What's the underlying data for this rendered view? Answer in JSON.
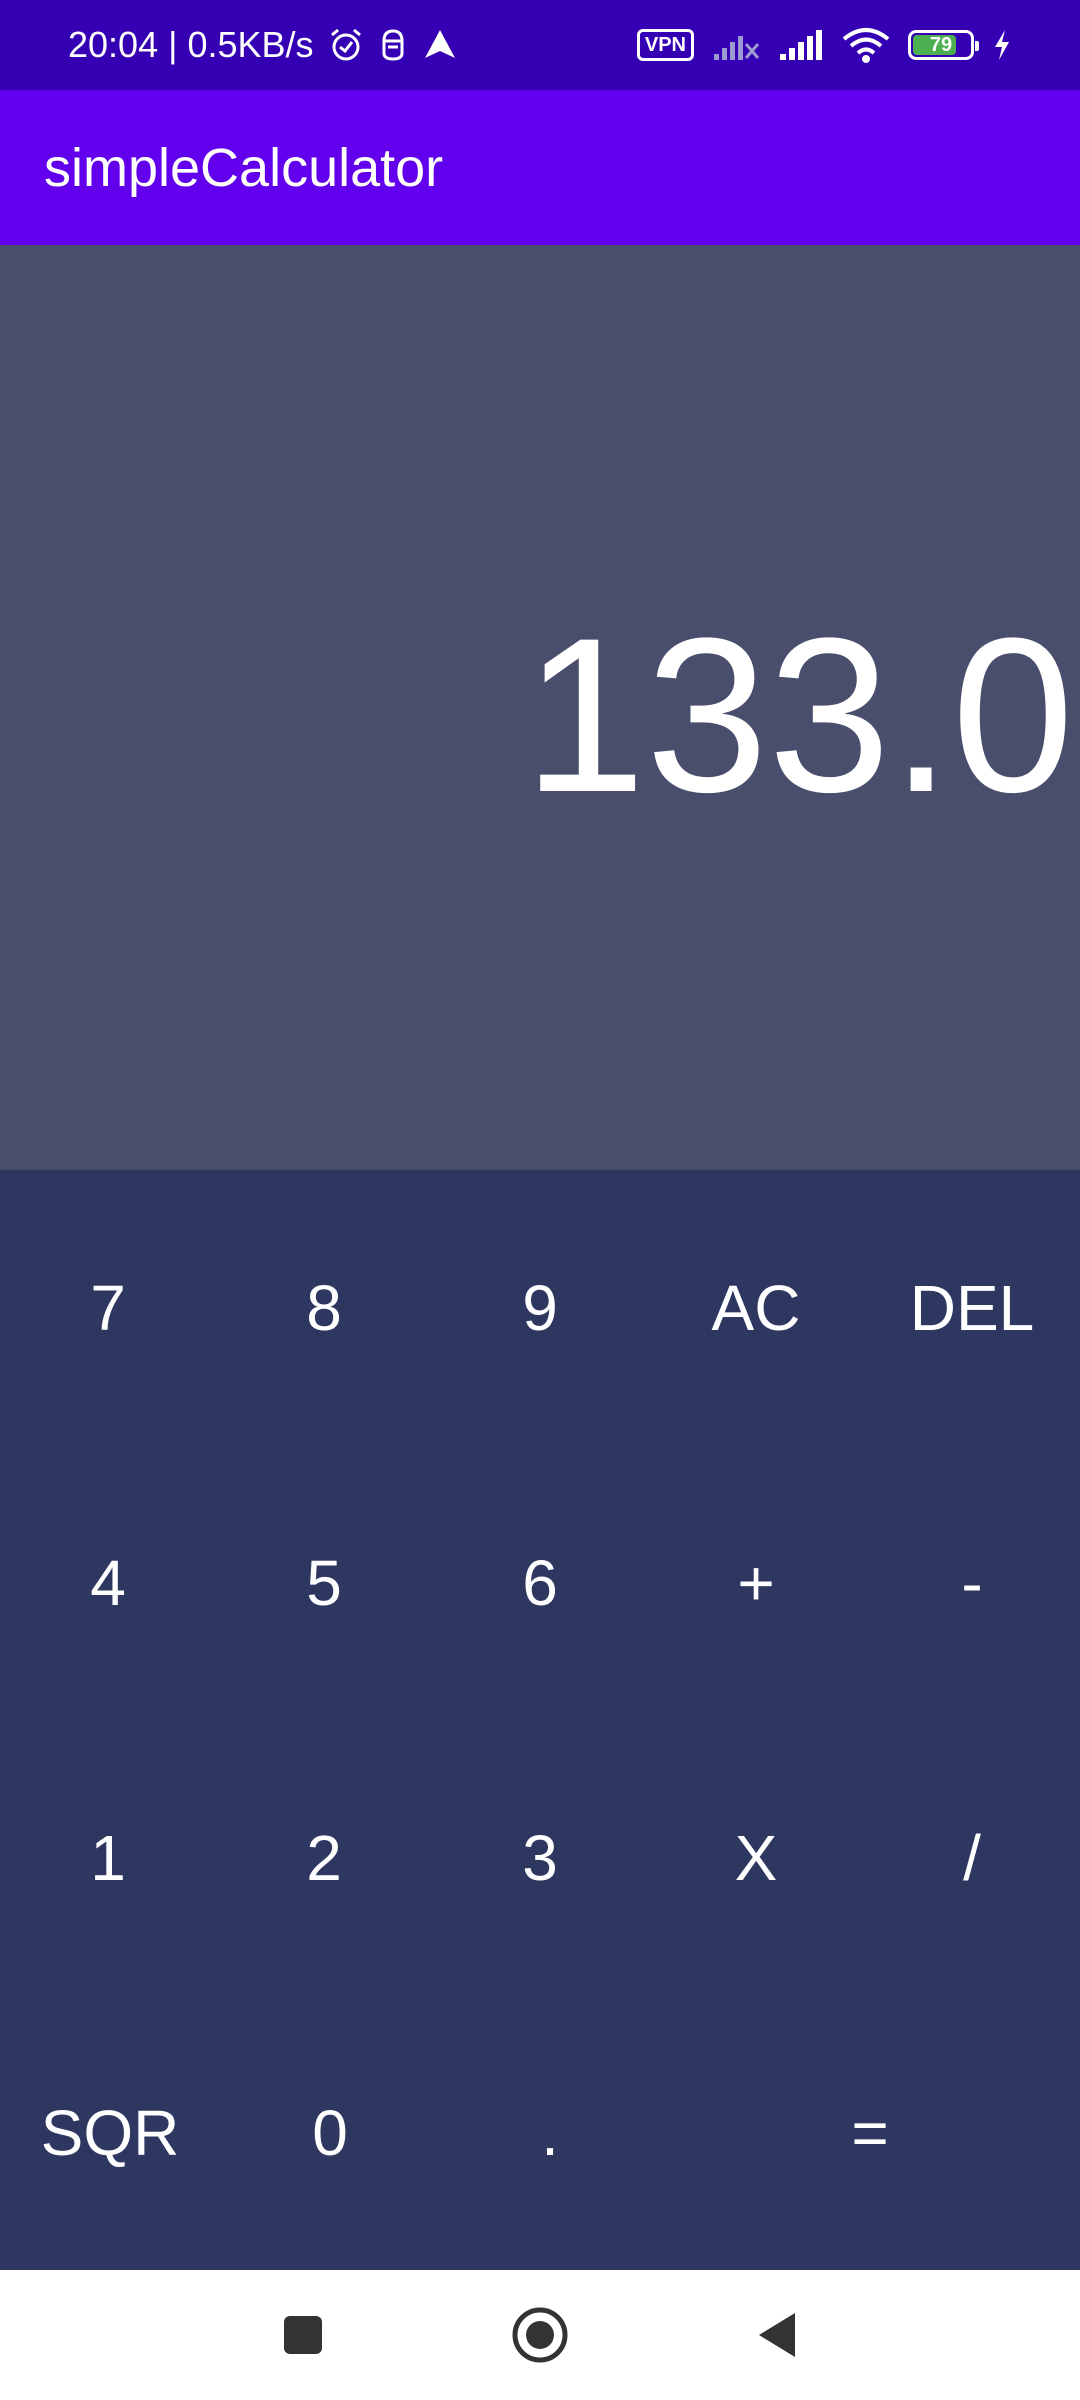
{
  "status_bar": {
    "time_speed": "20:04 | 0.5KB/s",
    "vpn_label": "VPN",
    "battery_level": "79",
    "battery_fraction": 0.79,
    "icons": [
      "alarm-icon",
      "hotspot-icon",
      "navigation-icon",
      "vpn-icon",
      "no-signal-icon",
      "signal-icon",
      "wifi-icon",
      "battery-icon",
      "charging-icon"
    ]
  },
  "app_bar": {
    "title": "simpleCalculator"
  },
  "display": {
    "value": "133.0"
  },
  "keypad": {
    "keys": [
      "7",
      "8",
      "9",
      "AC",
      "DEL",
      "4",
      "5",
      "6",
      "+",
      "-",
      "1",
      "2",
      "3",
      "X",
      "/",
      "SQR",
      "0",
      ".",
      "="
    ]
  },
  "nav_bar": {
    "icons": [
      "recents-icon",
      "home-icon",
      "back-icon"
    ]
  },
  "colors": {
    "status_bar": "#3500b4",
    "app_bar": "#6200ee",
    "display_bg": "#4a4e6d",
    "keypad_bg": "#2d3760",
    "nav_bg": "#ffffff"
  }
}
